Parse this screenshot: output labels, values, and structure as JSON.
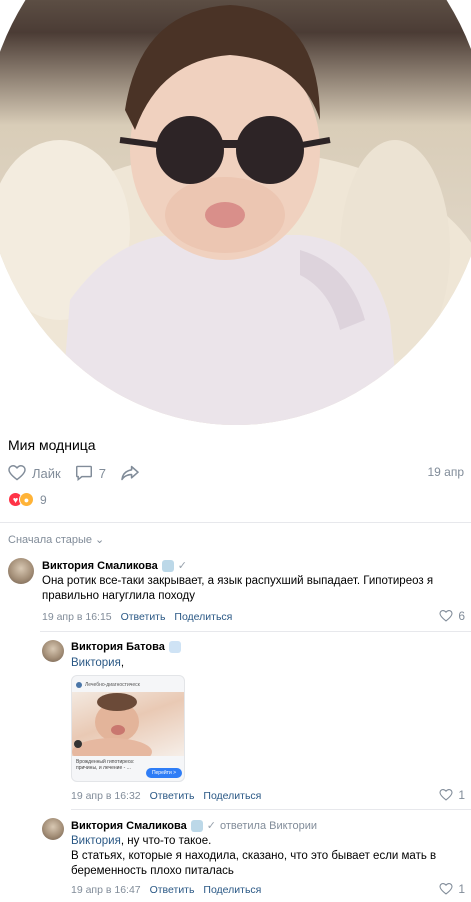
{
  "post": {
    "title": "Мия модница",
    "like_label": "Лайк",
    "comments_count": "7",
    "date": "19 апр",
    "reactions_count": "9"
  },
  "comments_sort": "Сначала старые",
  "comments": [
    {
      "author": "Виктория Смаликова",
      "text": "Она ротик все-таки закрывает, а язык распухший выпадает. Гипотиреоз я правильно нагуглила походу",
      "time": "19 апр в 16:15",
      "reply_label": "Ответить",
      "share_label": "Поделиться",
      "likes": "6"
    },
    {
      "author": "Виктория Батова",
      "mention": "Виктория",
      "text_after_mention": ",",
      "attachment": {
        "site": "Лечебно-диагностическ",
        "caption": "Врожденный гипотиреоз: причины, и лечение - ...",
        "button": "Перейти >"
      },
      "time": "19 апр в 16:32",
      "reply_label": "Ответить",
      "share_label": "Поделиться",
      "likes": "1"
    },
    {
      "author": "Виктория Смаликова",
      "replied_to": "ответила Виктории",
      "mention": "Виктория",
      "text_after_mention": ", ну что-то такое.",
      "text_line2": "В статьях, которые я находила, сказано, что это бывает если мать в беременность плохо питалась",
      "time": "19 апр в 16:47",
      "reply_label": "Ответить",
      "share_label": "Поделиться",
      "likes": "1"
    }
  ],
  "colors": {
    "link": "#2a5885",
    "meta": "#818c99",
    "heart": "#ff3347"
  }
}
